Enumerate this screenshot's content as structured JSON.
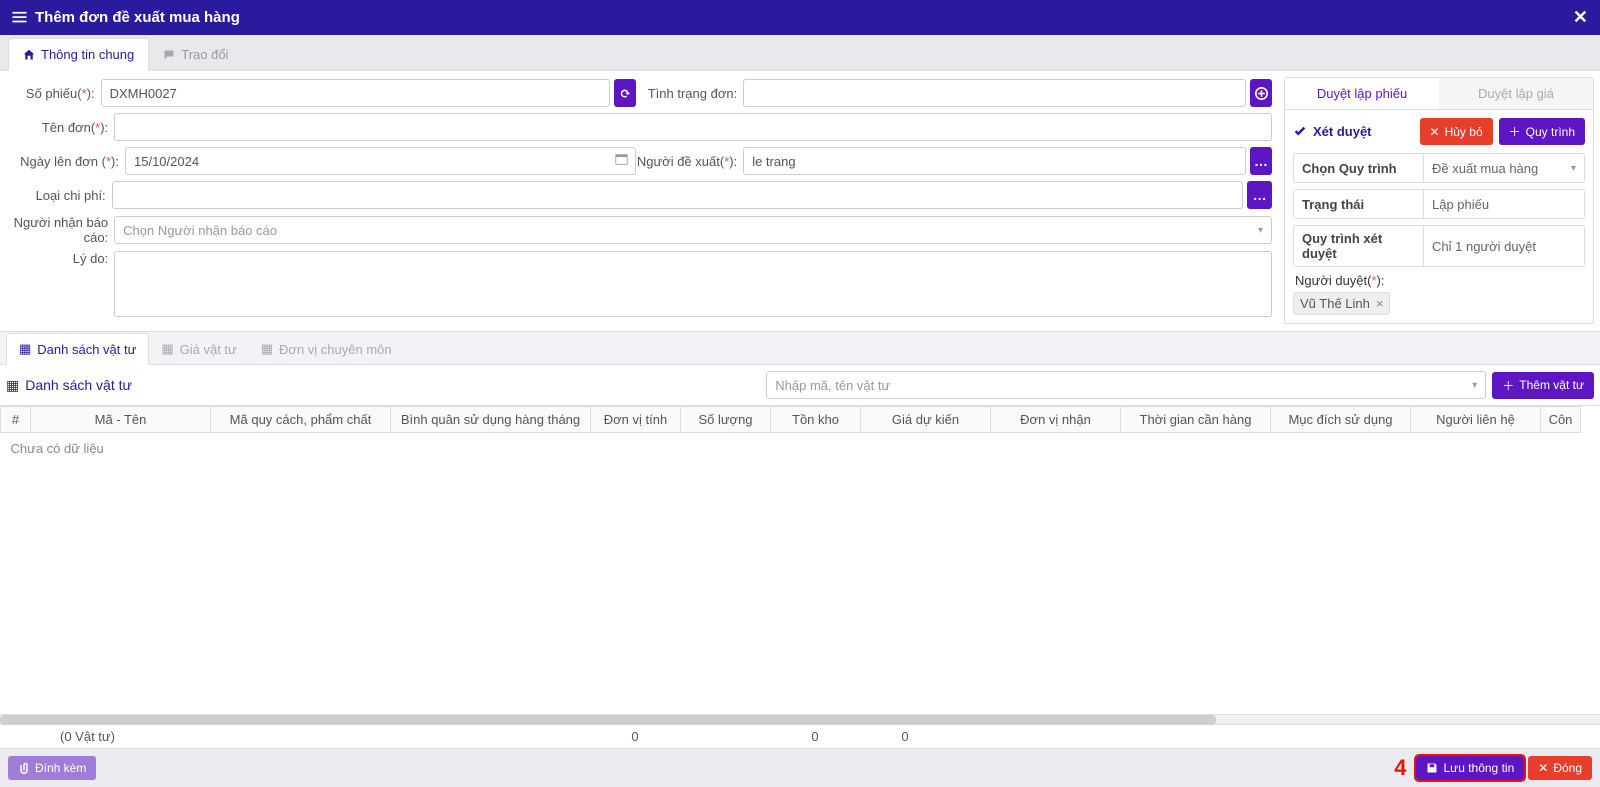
{
  "header": {
    "title": "Thêm đơn đề xuất mua hàng"
  },
  "tabs": {
    "general": "Thông tin chung",
    "discuss": "Trao đổi"
  },
  "form": {
    "voucher_no_label": "Số phiếu(",
    "req": "*",
    "voucher_no": "DXMH0027",
    "status_label": "Tình trạng đơn:",
    "name_label": "Tên đơn(",
    "name": "",
    "date_label": "Ngày lên đơn (",
    "date": "15/10/2024",
    "proposer_label": "Người đề xuất(",
    "proposer": "le trang",
    "cost_type_label": "Loại chi phí:",
    "cost_type": "",
    "report_to_label": "Người nhận báo cáo:",
    "report_to_placeholder": "Chọn Người nhận báo cáo",
    "reason_label": "Lý do:",
    "reason": ""
  },
  "side": {
    "tab1": "Duyệt lập phiếu",
    "tab2": "Duyệt lập giá",
    "approve_title": "Xét duyệt",
    "cancel_btn": "Hủy bỏ",
    "process_btn": "Quy trình",
    "select_process_label": "Chọn Quy trình",
    "select_process_value": "Đề xuất mua hàng",
    "status_label": "Trạng thái",
    "status_value": "Lập phiếu",
    "process_label": "Quy trình xét duyệt",
    "process_value": "Chỉ 1 người duyệt",
    "reviewer_label": "Người duyệt(",
    "reviewer_tag": "Vũ Thế Linh"
  },
  "subtabs": {
    "t1": "Danh sách vật tư",
    "t2": "Giá vật tư",
    "t3": "Đơn vị chuyên môn"
  },
  "list": {
    "title": "Danh sách vật tư",
    "search_placeholder": "Nhập mã, tên vật tư",
    "add_btn": "Thêm vật tư",
    "cols": {
      "c0": "#",
      "c1": "Mã - Tên",
      "c2": "Mã quy cách, phẩm chất",
      "c3": "Bình quân sử dụng hàng tháng",
      "c4": "Đơn vị tính",
      "c5": "Số lượng",
      "c6": "Tồn kho",
      "c7": "Giá dự kiến",
      "c8": "Đơn vị nhận",
      "c9": "Thời gian cần hàng",
      "c10": "Mục đích sử dụng",
      "c11": "Người liên hệ",
      "c12": "Côn"
    },
    "empty": "Chưa có dữ liệu",
    "summary_count": "(0 Vật tư)",
    "summary_v1": "0",
    "summary_v2": "0",
    "summary_v3": "0"
  },
  "footer": {
    "attach": "Đính kèm",
    "annotation": "4",
    "save": "Lưu thông tin",
    "close": "Đóng"
  }
}
